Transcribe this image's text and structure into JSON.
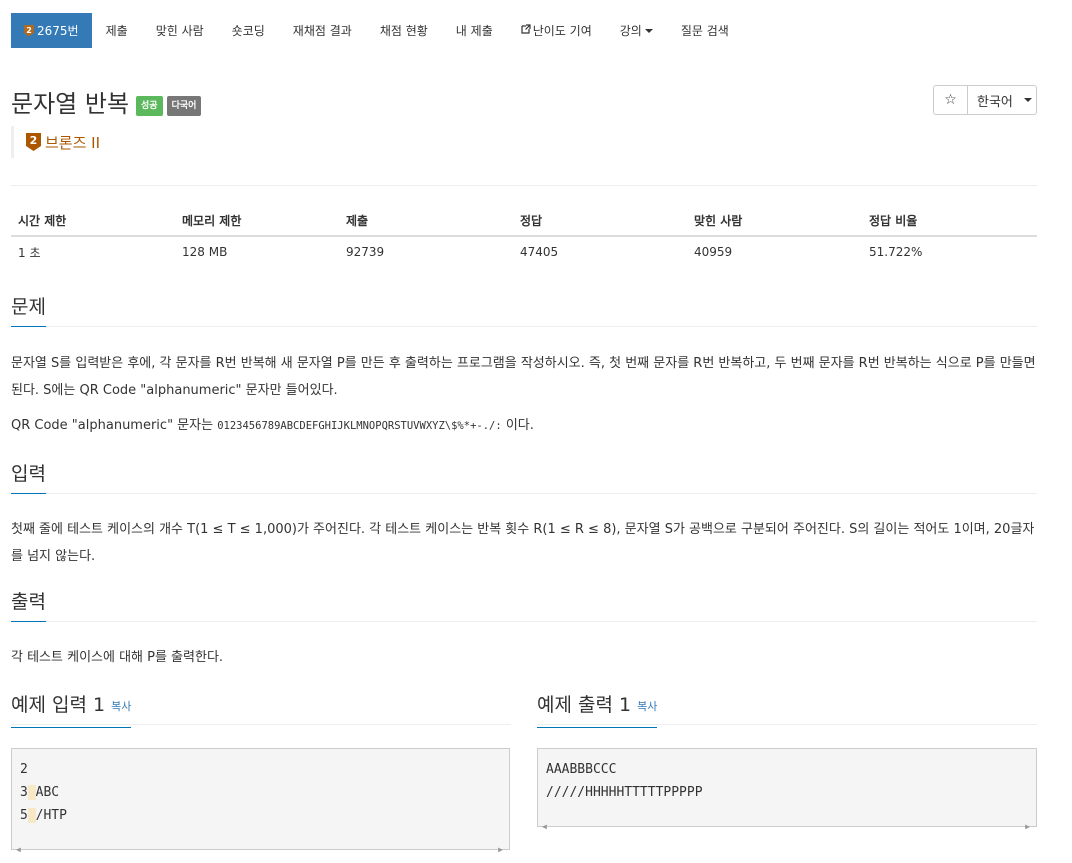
{
  "tabs": [
    {
      "label": "2675번",
      "active": true,
      "icon": "bronze-badge-icon",
      "icon_text": "2"
    },
    {
      "label": "제출"
    },
    {
      "label": "맞힌 사람"
    },
    {
      "label": "숏코딩"
    },
    {
      "label": "재채점 결과"
    },
    {
      "label": "채점 현황"
    },
    {
      "label": "내 제출"
    },
    {
      "label": "난이도 기여",
      "icon": "external-link-icon"
    },
    {
      "label": "강의",
      "dropdown": true
    },
    {
      "label": "질문 검색"
    }
  ],
  "problem": {
    "title": "문자열 반복",
    "labels": {
      "success": "성공",
      "multilang": "다국어"
    },
    "tier": {
      "level": "2",
      "name": "브론즈 II"
    }
  },
  "lang": {
    "star": "☆",
    "selected": "한국어"
  },
  "info_table": {
    "headers": [
      "시간 제한",
      "메모리 제한",
      "제출",
      "정답",
      "맞힌 사람",
      "정답 비율"
    ],
    "values": [
      "1 초",
      "128 MB",
      "92739",
      "47405",
      "40959",
      "51.722%"
    ]
  },
  "sections": {
    "problem_heading": "문제",
    "problem_text_1": "문자열 S를 입력받은 후에, 각 문자를 R번 반복해 새 문자열 P를 만든 후 출력하는 프로그램을 작성하시오. 즉, 첫 번째 문자를 R번 반복하고, 두 번째 문자를 R번 반복하는 식으로 P를 만들면 된다. S에는 QR Code \"alphanumeric\" 문자만 들어있다.",
    "problem_text_2a": "QR Code \"alphanumeric\" 문자는 ",
    "problem_text_2_code": "0123456789ABCDEFGHIJKLMNOPQRSTUVWXYZ\\$%*+-./:",
    "problem_text_2b": " 이다.",
    "input_heading": "입력",
    "input_text": "첫째 줄에 테스트 케이스의 개수 T(1 ≤ T ≤ 1,000)가 주어진다. 각 테스트 케이스는 반복 횟수 R(1 ≤ R ≤ 8), 문자열 S가 공백으로 구분되어 주어진다. S의 길이는 적어도 1이며, 20글자를 넘지 않는다.",
    "output_heading": "출력",
    "output_text": "각 테스트 케이스에 대해 P를 출력한다."
  },
  "examples": {
    "input_heading": "예제 입력 1",
    "output_heading": "예제 출력 1",
    "copy_label": "복사",
    "input_lines": [
      {
        "num": "2",
        "text": ""
      },
      {
        "num": "3",
        "text": "ABC"
      },
      {
        "num": "5",
        "text": "/HTP"
      }
    ],
    "output_lines": [
      "AAABBBCCC",
      "/////HHHHHTTTTTPPPPP"
    ]
  }
}
